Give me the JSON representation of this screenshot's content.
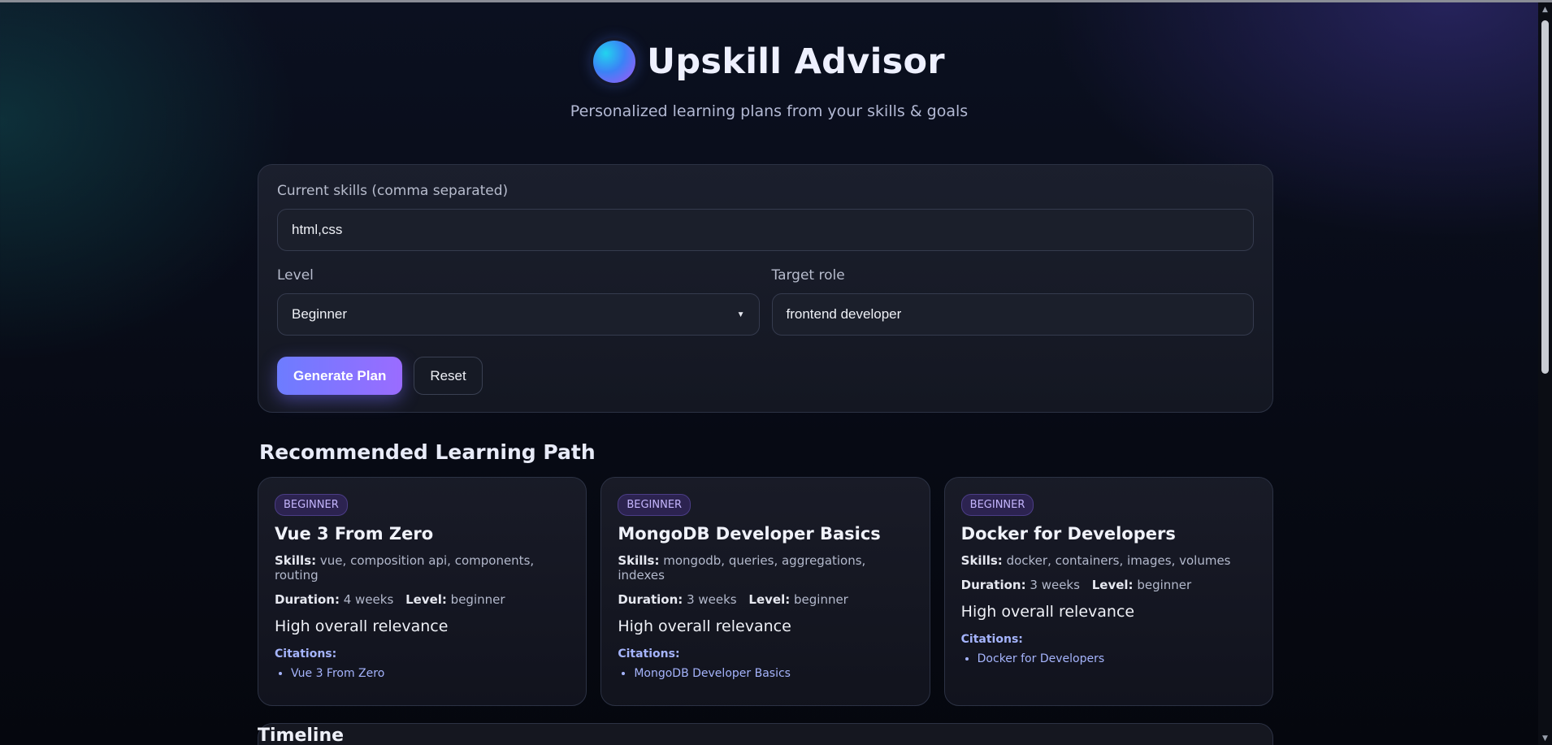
{
  "header": {
    "title": "Upskill Advisor",
    "subtitle": "Personalized learning plans from your skills & goals"
  },
  "form": {
    "skills_label": "Current skills (comma separated)",
    "skills_value": "html,css",
    "level_label": "Level",
    "level_value": "Beginner",
    "target_label": "Target role",
    "target_value": "frontend developer",
    "generate_label": "Generate Plan",
    "reset_label": "Reset"
  },
  "results": {
    "section_title": "Recommended Learning Path",
    "cards": [
      {
        "badge": "BEGINNER",
        "title": "Vue 3 From Zero",
        "skills_label": "Skills:",
        "skills": "vue, composition api, components, routing",
        "duration_label": "Duration:",
        "duration": "4 weeks",
        "level_label": "Level:",
        "level": "beginner",
        "relevance": "High overall relevance",
        "citations_label": "Citations:",
        "citations": [
          "Vue 3 From Zero"
        ]
      },
      {
        "badge": "BEGINNER",
        "title": "MongoDB Developer Basics",
        "skills_label": "Skills:",
        "skills": "mongodb, queries, aggregations, indexes",
        "duration_label": "Duration:",
        "duration": "3 weeks",
        "level_label": "Level:",
        "level": "beginner",
        "relevance": "High overall relevance",
        "citations_label": "Citations:",
        "citations": [
          "MongoDB Developer Basics"
        ]
      },
      {
        "badge": "BEGINNER",
        "title": "Docker for Developers",
        "skills_label": "Skills:",
        "skills": "docker, containers, images, volumes",
        "duration_label": "Duration:",
        "duration": "3 weeks",
        "level_label": "Level:",
        "level": "beginner",
        "relevance": "High overall relevance",
        "citations_label": "Citations:",
        "citations": [
          "Docker for Developers"
        ]
      }
    ]
  },
  "timeline": {
    "title": "Timeline"
  }
}
